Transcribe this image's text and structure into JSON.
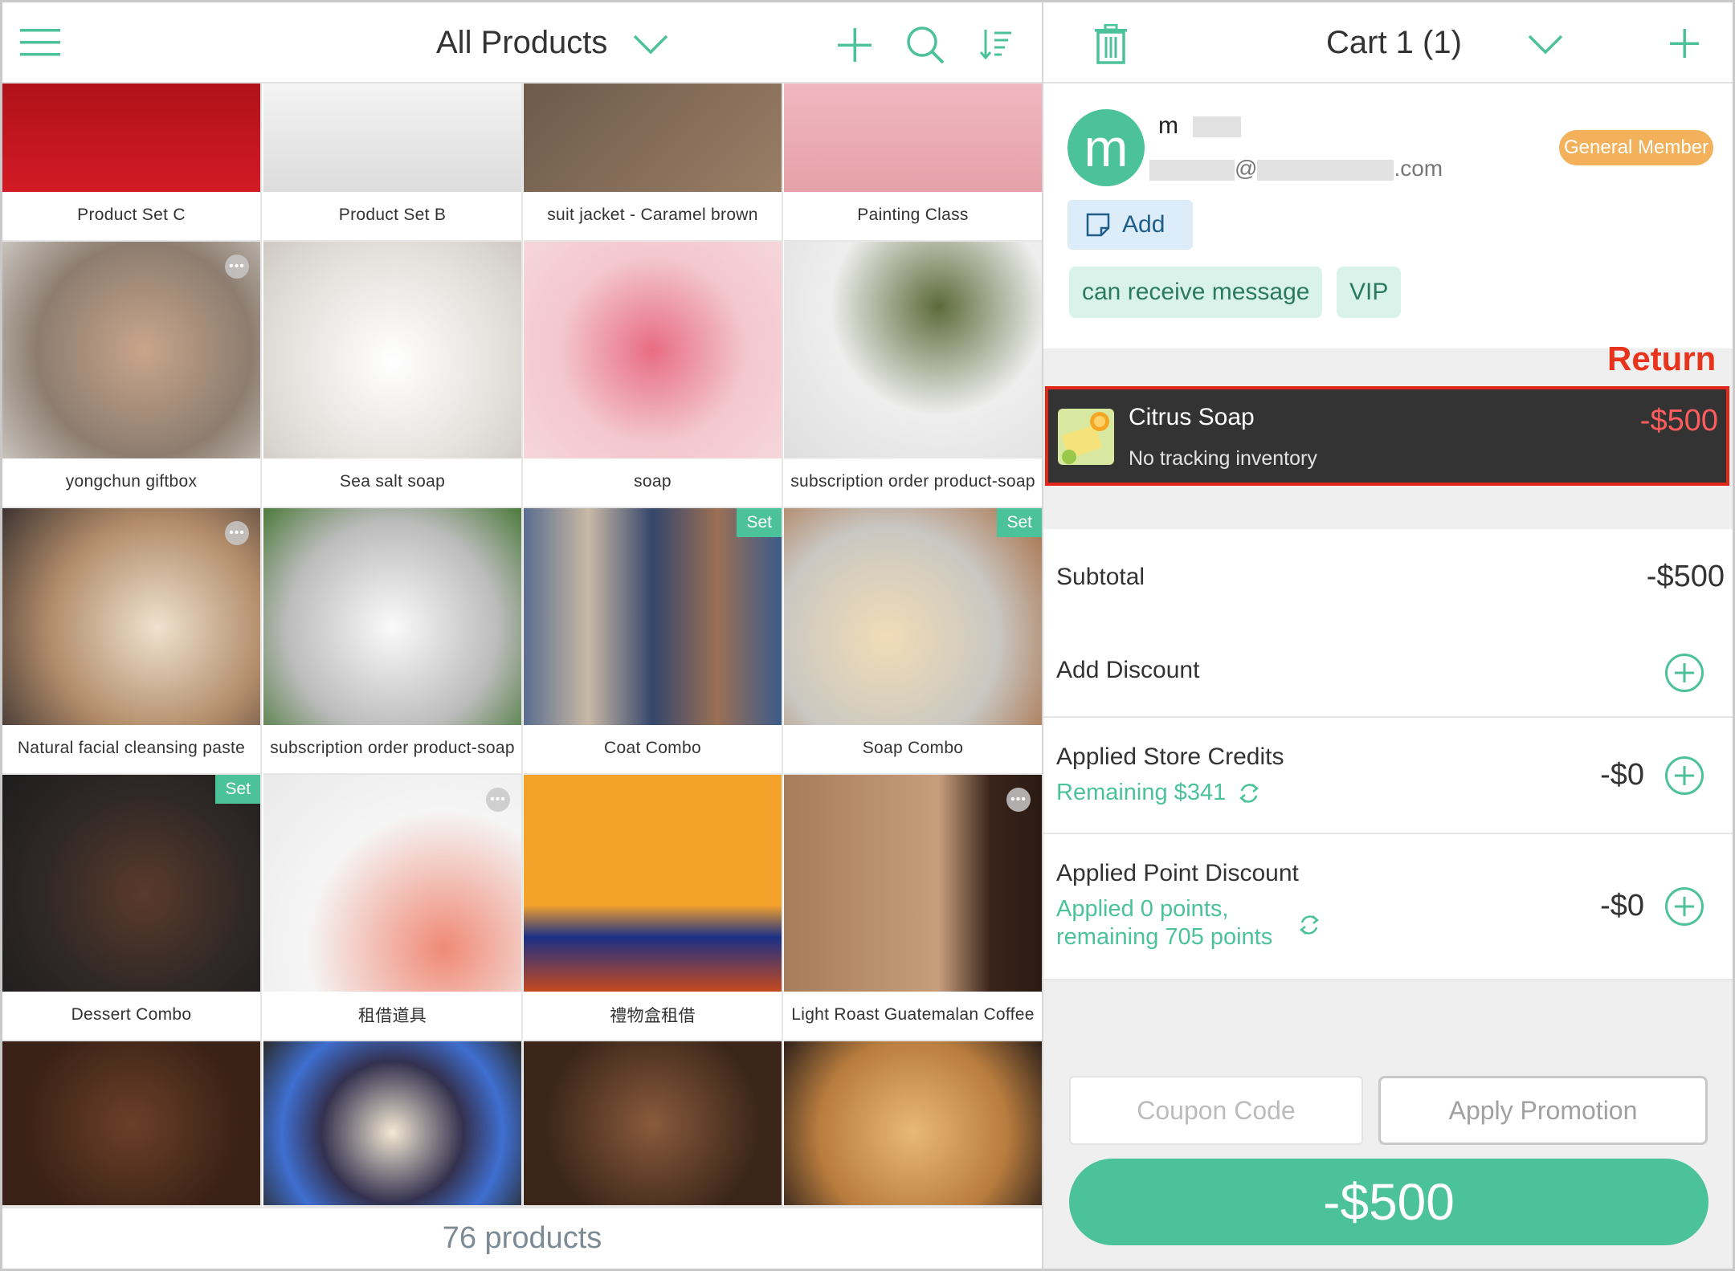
{
  "left_header": {
    "title": "All Products"
  },
  "products": [
    {
      "name": "Product Set C",
      "badge": "",
      "menu": false
    },
    {
      "name": "Product Set B",
      "badge": "",
      "menu": false
    },
    {
      "name": "suit jacket - Caramel brown",
      "badge": "",
      "menu": false
    },
    {
      "name": "Painting Class",
      "badge": "",
      "menu": false
    },
    {
      "name": "yongchun giftbox",
      "badge": "",
      "menu": true
    },
    {
      "name": "Sea salt soap",
      "badge": "",
      "menu": false
    },
    {
      "name": "soap",
      "badge": "",
      "menu": false
    },
    {
      "name": "subscription order product-soap",
      "badge": "",
      "menu": false
    },
    {
      "name": "Natural facial cleansing paste",
      "badge": "",
      "menu": true
    },
    {
      "name": "subscription order product-soap",
      "badge": "",
      "menu": false
    },
    {
      "name": "Coat Combo",
      "badge": "Set",
      "menu": false
    },
    {
      "name": "Soap Combo",
      "badge": "Set",
      "menu": false
    },
    {
      "name": "Dessert Combo",
      "badge": "Set",
      "menu": false
    },
    {
      "name": "租借道具",
      "badge": "",
      "menu": true
    },
    {
      "name": "禮物盒租借",
      "badge": "",
      "menu": false
    },
    {
      "name": "Light Roast Guatemalan Coffee",
      "badge": "",
      "menu": true
    }
  ],
  "product_count": "76 products",
  "cart": {
    "title": "Cart 1 (1)",
    "customer": {
      "initial": "m",
      "name_prefix": "m",
      "email_at": "@",
      "email_suffix": ".com",
      "membership": "General Member",
      "add_note_label": "Add",
      "tags": [
        "can receive message",
        "VIP"
      ]
    },
    "return_label": "Return",
    "item": {
      "name": "Citrus Soap",
      "note": "No tracking inventory",
      "price": "-$500"
    },
    "subtotal": {
      "label": "Subtotal",
      "value": "-$500"
    },
    "add_discount": {
      "label": "Add Discount"
    },
    "store_credits": {
      "label": "Applied Store Credits",
      "sub": "Remaining $341",
      "value": "-$0"
    },
    "point_discount": {
      "label": "Applied Point Discount",
      "sub_line1": "Applied 0 points,",
      "sub_line2": "remaining 705 points",
      "value": "-$0"
    },
    "coupon_placeholder": "Coupon Code",
    "apply_promotion": "Apply Promotion",
    "checkout_total": "-$500"
  },
  "colors": {
    "accent": "#4cc29b",
    "member_badge": "#f2b15a",
    "return_red": "#e8341c"
  }
}
